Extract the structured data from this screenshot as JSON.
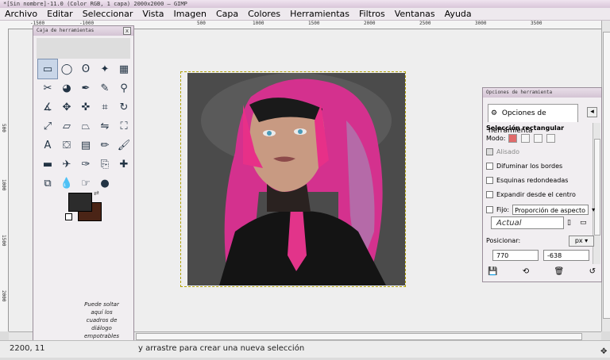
{
  "window": {
    "title": "*[Sin nombre]-11.0 (Color RGB, 1 capa) 2000x2000 – GIMP"
  },
  "menubar": {
    "items": [
      "Archivo",
      "Editar",
      "Seleccionar",
      "Vista",
      "Imagen",
      "Capa",
      "Colores",
      "Herramientas",
      "Filtros",
      "Ventanas",
      "Ayuda"
    ]
  },
  "ruler": {
    "h_ticks": [
      "-1500",
      "-1000",
      "500",
      "1000",
      "1500",
      "2000",
      "2500",
      "3000",
      "3500"
    ],
    "v_ticks": [
      "500",
      "1000",
      "1500",
      "2000"
    ]
  },
  "toolbox": {
    "title": "Caja de herramientas",
    "close": "x",
    "tools": [
      {
        "name": "rect-select-icon",
        "glyph": "▭"
      },
      {
        "name": "ellipse-select-icon",
        "glyph": "◯"
      },
      {
        "name": "free-select-icon",
        "glyph": "ʘ"
      },
      {
        "name": "fuzzy-select-icon",
        "glyph": "✦"
      },
      {
        "name": "select-by-color-icon",
        "glyph": "▦"
      },
      {
        "name": "scissors-icon",
        "glyph": "✂"
      },
      {
        "name": "foreground-select-icon",
        "glyph": "◕"
      },
      {
        "name": "paths-icon",
        "glyph": "✒"
      },
      {
        "name": "color-picker-icon",
        "glyph": "✎"
      },
      {
        "name": "zoom-icon",
        "glyph": "⚲"
      },
      {
        "name": "measure-icon",
        "glyph": "∡"
      },
      {
        "name": "move-icon",
        "glyph": "✥"
      },
      {
        "name": "align-icon",
        "glyph": "✜"
      },
      {
        "name": "crop-icon",
        "glyph": "⌗"
      },
      {
        "name": "rotate-icon",
        "glyph": "↻"
      },
      {
        "name": "scale-icon",
        "glyph": "⤢"
      },
      {
        "name": "shear-icon",
        "glyph": "▱"
      },
      {
        "name": "perspective-icon",
        "glyph": "⏢"
      },
      {
        "name": "flip-icon",
        "glyph": "⇋"
      },
      {
        "name": "cage-icon",
        "glyph": "⛶"
      },
      {
        "name": "text-icon",
        "glyph": "A"
      },
      {
        "name": "bucket-fill-icon",
        "glyph": "⛋"
      },
      {
        "name": "blend-icon",
        "glyph": "▤"
      },
      {
        "name": "pencil-icon",
        "glyph": "✏"
      },
      {
        "name": "paintbrush-icon",
        "glyph": "🖌"
      },
      {
        "name": "eraser-icon",
        "glyph": "▬"
      },
      {
        "name": "airbrush-icon",
        "glyph": "✈"
      },
      {
        "name": "ink-icon",
        "glyph": "✑"
      },
      {
        "name": "clone-icon",
        "glyph": "⎘"
      },
      {
        "name": "heal-icon",
        "glyph": "✚"
      },
      {
        "name": "perspective-clone-icon",
        "glyph": "⧉"
      },
      {
        "name": "blur-icon",
        "glyph": "💧"
      },
      {
        "name": "smudge-icon",
        "glyph": "☞"
      },
      {
        "name": "dodge-burn-icon",
        "glyph": "●"
      }
    ],
    "drop_hint": "Puede soltar aquí los cuadros de diálogo empotrables"
  },
  "tool_options": {
    "title": "Opciones de herramienta",
    "tab_label": "Opciones de herramienta",
    "section": "Selección rectangular",
    "modo_label": "Modo:",
    "alisado": "Alisado",
    "difuminar": "Difuminar los bordes",
    "esquinas": "Esquinas redondeadas",
    "expandir": "Expandir desde el centro",
    "fijo_label": "Fijo:",
    "fijo_value": "Proporción de aspecto",
    "actual": "Actual",
    "posicionar": "Posicionar:",
    "unit": "px",
    "pos_x": "770",
    "pos_y": "-638"
  },
  "status": {
    "coords": "2200, 11",
    "message": "y arrastre para crear una nueva selección"
  }
}
